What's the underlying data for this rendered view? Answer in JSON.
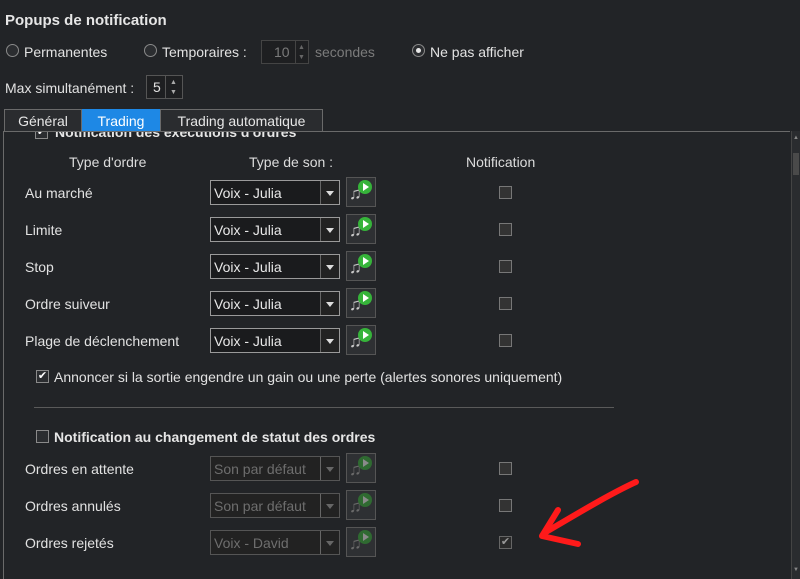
{
  "title": "Popups de notification",
  "popup_mode": {
    "options": [
      {
        "label": "Permanentes",
        "checked": false
      },
      {
        "label": "Temporaires :",
        "checked": false
      },
      {
        "label": "Ne pas afficher",
        "checked": true
      }
    ],
    "duration_value": "10",
    "duration_unit": "secondes"
  },
  "max": {
    "label": "Max simultanément :",
    "value": "5"
  },
  "tabs": [
    "Général",
    "Trading",
    "Trading automatique"
  ],
  "active_tab": "Trading",
  "exec_section": {
    "title": "Notification des exécutions d'ordres",
    "checked": true,
    "headers": {
      "order_type": "Type d'ordre",
      "sound_type": "Type de son :",
      "notification": "Notification"
    },
    "rows": [
      {
        "label": "Au marché",
        "sound": "Voix - Julia",
        "notify": false
      },
      {
        "label": "Limite",
        "sound": "Voix - Julia",
        "notify": false
      },
      {
        "label": "Stop",
        "sound": "Voix - Julia",
        "notify": false
      },
      {
        "label": "Ordre suiveur",
        "sound": "Voix - Julia",
        "notify": false
      },
      {
        "label": "Plage de déclenchement",
        "sound": "Voix - Julia",
        "notify": false
      }
    ],
    "announce": {
      "label": "Annoncer si la sortie engendre un gain ou une perte (alertes sonores uniquement)",
      "checked": true
    }
  },
  "status_section": {
    "title": "Notification au changement de statut des ordres",
    "checked": false,
    "rows": [
      {
        "label": "Ordres en attente",
        "sound": "Son par défaut",
        "notify": false
      },
      {
        "label": "Ordres annulés",
        "sound": "Son par défaut",
        "notify": false
      },
      {
        "label": "Ordres rejetés",
        "sound": "Voix - David",
        "notify": true
      }
    ]
  },
  "colors": {
    "accent": "#1e88e5",
    "annotation_arrow": "#ff1a1a",
    "play_green": "#36b43a"
  },
  "icons": {
    "play": "play-sound-icon",
    "note": "music-note-icon",
    "check": "checkmark-icon"
  }
}
